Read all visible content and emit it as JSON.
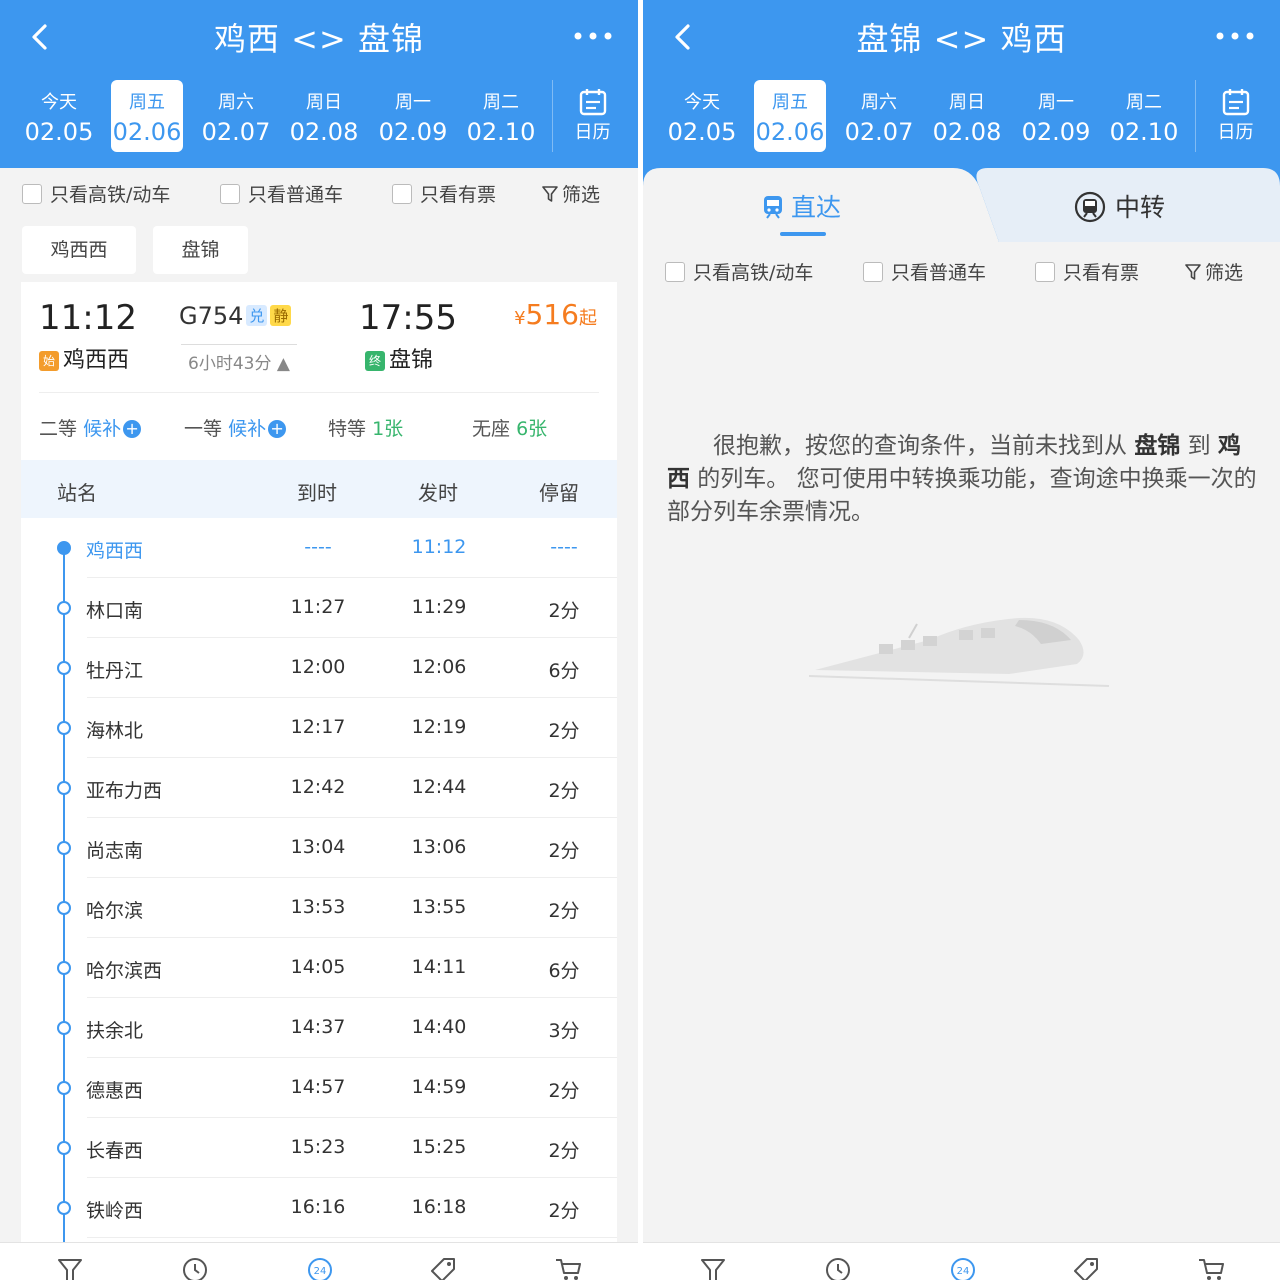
{
  "left": {
    "title": "鸡西 <> 盘锦",
    "dates": [
      {
        "week": "今天",
        "date": "02.05"
      },
      {
        "week": "周五",
        "date": "02.06"
      },
      {
        "week": "周六",
        "date": "02.07"
      },
      {
        "week": "周日",
        "date": "02.08"
      },
      {
        "week": "周一",
        "date": "02.09"
      },
      {
        "week": "周二",
        "date": "02.10"
      }
    ],
    "calendar_label": "日历",
    "filters": {
      "high_speed": "只看高铁/动车",
      "normal": "只看普通车",
      "has_ticket": "只看有票",
      "sift": "筛选"
    },
    "station_pills": [
      "鸡西西",
      "盘锦"
    ],
    "train": {
      "dep_time": "11:12",
      "dep_station": "鸡西西",
      "dep_tag": "始",
      "number": "G754",
      "badge1": "兑",
      "badge2": "静",
      "duration": "6小时43分 ▲",
      "arr_time": "17:55",
      "arr_station": "盘锦",
      "arr_tag": "终",
      "price_symbol": "¥",
      "price": "516",
      "price_suffix": "起",
      "seats": [
        {
          "name": "二等",
          "value": "候补"
        },
        {
          "name": "一等",
          "value": "候补"
        },
        {
          "name": "特等",
          "value": "1张"
        },
        {
          "name": "无座",
          "value": "6张"
        }
      ]
    },
    "stop_header": {
      "name": "站名",
      "arrive": "到时",
      "depart": "发时",
      "stay": "停留"
    },
    "stops": [
      {
        "name": "鸡西西",
        "arrive": "----",
        "depart": "11:12",
        "stay": "----"
      },
      {
        "name": "林口南",
        "arrive": "11:27",
        "depart": "11:29",
        "stay": "2分"
      },
      {
        "name": "牡丹江",
        "arrive": "12:00",
        "depart": "12:06",
        "stay": "6分"
      },
      {
        "name": "海林北",
        "arrive": "12:17",
        "depart": "12:19",
        "stay": "2分"
      },
      {
        "name": "亚布力西",
        "arrive": "12:42",
        "depart": "12:44",
        "stay": "2分"
      },
      {
        "name": "尚志南",
        "arrive": "13:04",
        "depart": "13:06",
        "stay": "2分"
      },
      {
        "name": "哈尔滨",
        "arrive": "13:53",
        "depart": "13:55",
        "stay": "2分"
      },
      {
        "name": "哈尔滨西",
        "arrive": "14:05",
        "depart": "14:11",
        "stay": "6分"
      },
      {
        "name": "扶余北",
        "arrive": "14:37",
        "depart": "14:40",
        "stay": "3分"
      },
      {
        "name": "德惠西",
        "arrive": "14:57",
        "depart": "14:59",
        "stay": "2分"
      },
      {
        "name": "长春西",
        "arrive": "15:23",
        "depart": "15:25",
        "stay": "2分"
      },
      {
        "name": "铁岭西",
        "arrive": "16:16",
        "depart": "16:18",
        "stay": "2分"
      }
    ]
  },
  "right": {
    "title": "盘锦 <> 鸡西",
    "dates": [
      {
        "week": "今天",
        "date": "02.05"
      },
      {
        "week": "周五",
        "date": "02.06"
      },
      {
        "week": "周六",
        "date": "02.07"
      },
      {
        "week": "周日",
        "date": "02.08"
      },
      {
        "week": "周一",
        "date": "02.09"
      },
      {
        "week": "周二",
        "date": "02.10"
      }
    ],
    "calendar_label": "日历",
    "tabs": {
      "direct": "直达",
      "transfer": "中转"
    },
    "filters": {
      "high_speed": "只看高铁/动车",
      "normal": "只看普通车",
      "has_ticket": "只看有票",
      "sift": "筛选"
    },
    "empty": {
      "part1": "很抱歉，按您的查询条件，当前未找到从 ",
      "from": "盘锦",
      "part2": " 到 ",
      "to": "鸡西",
      "part3": " 的列车。 您可使用中转换乘功能，查询途中换乘一次的部分列车余票情况。"
    }
  },
  "colors": {
    "primary": "#3d97ef",
    "price": "#f57c1f",
    "green": "#37b56d"
  },
  "bottom_nav_icons": [
    "filter-icon",
    "clock-icon",
    "24h-icon",
    "tag-icon",
    "cart-icon"
  ],
  "bottom_nav_badge": "24"
}
